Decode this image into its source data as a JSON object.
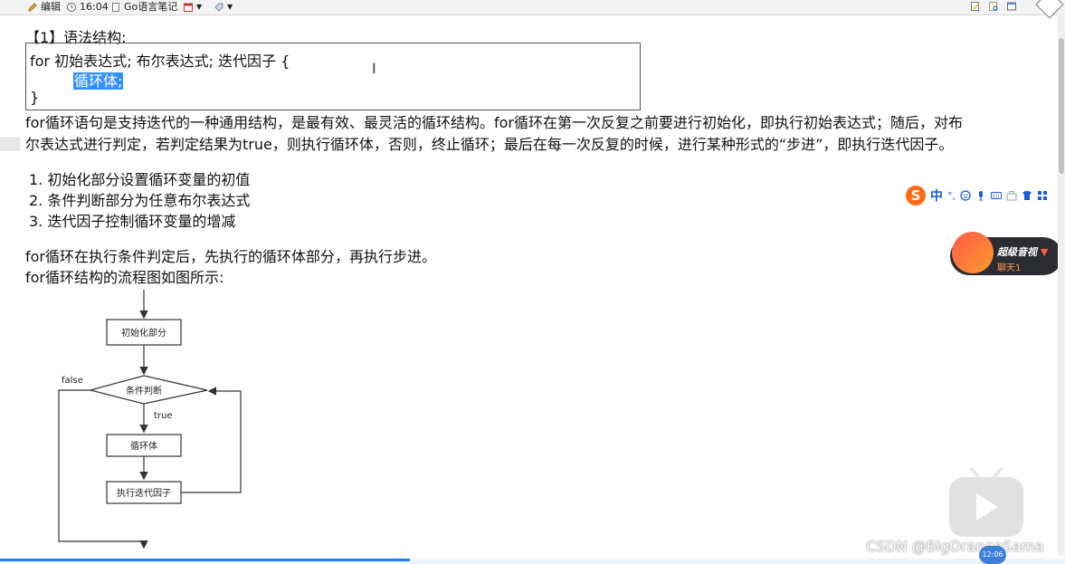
{
  "toolbar": {
    "edit_label": "编辑",
    "time": "16:04",
    "notebook": "Go语言笔记"
  },
  "content": {
    "heading": "【1】语法结构:",
    "code": {
      "line1": "for 初始表达式; 布尔表达式; 迭代因子 {",
      "line2": "循环体;",
      "line3": "}"
    },
    "cursor_glyph": "I",
    "para1_line1": "for循环语句是支持迭代的一种通用结构，是最有效、最灵活的循环结构。for循环在第一次反复之前要进行初始化，即执行初始表达式；随后，对布",
    "para1_line2": "尔表达式进行判定，若判定结果为true，则执行循环体，否则，终止循环；最后在每一次反复的时候，进行某种形式的“步进”，即执行迭代因子。",
    "list": [
      "1.  初始化部分设置循环变量的初值",
      "2.  条件判断部分为任意布尔表达式",
      "3.  迭代因子控制循环变量的增减"
    ],
    "para2": "for循环在执行条件判定后，先执行的循环体部分，再执行步进。",
    "para3": "for循环结构的流程图如图所示:"
  },
  "flowchart": {
    "init": "初始化部分",
    "cond": "条件判断",
    "body": "循环体",
    "iter": "执行迭代因子",
    "false_label": "false",
    "true_label": "true"
  },
  "ime": {
    "logo": "S",
    "lang": "中",
    "punct": "°,"
  },
  "promo": {
    "title": "超级音视",
    "subtitle": "聊天1"
  },
  "video": {
    "progress_fraction": 0.385,
    "time_badge": "12:06"
  },
  "watermark": "CSDN @BigOrangeSama",
  "colors": {
    "selection": "#3390ff",
    "progress": "#1e7fff",
    "ime_accent": "#ff6a13"
  }
}
